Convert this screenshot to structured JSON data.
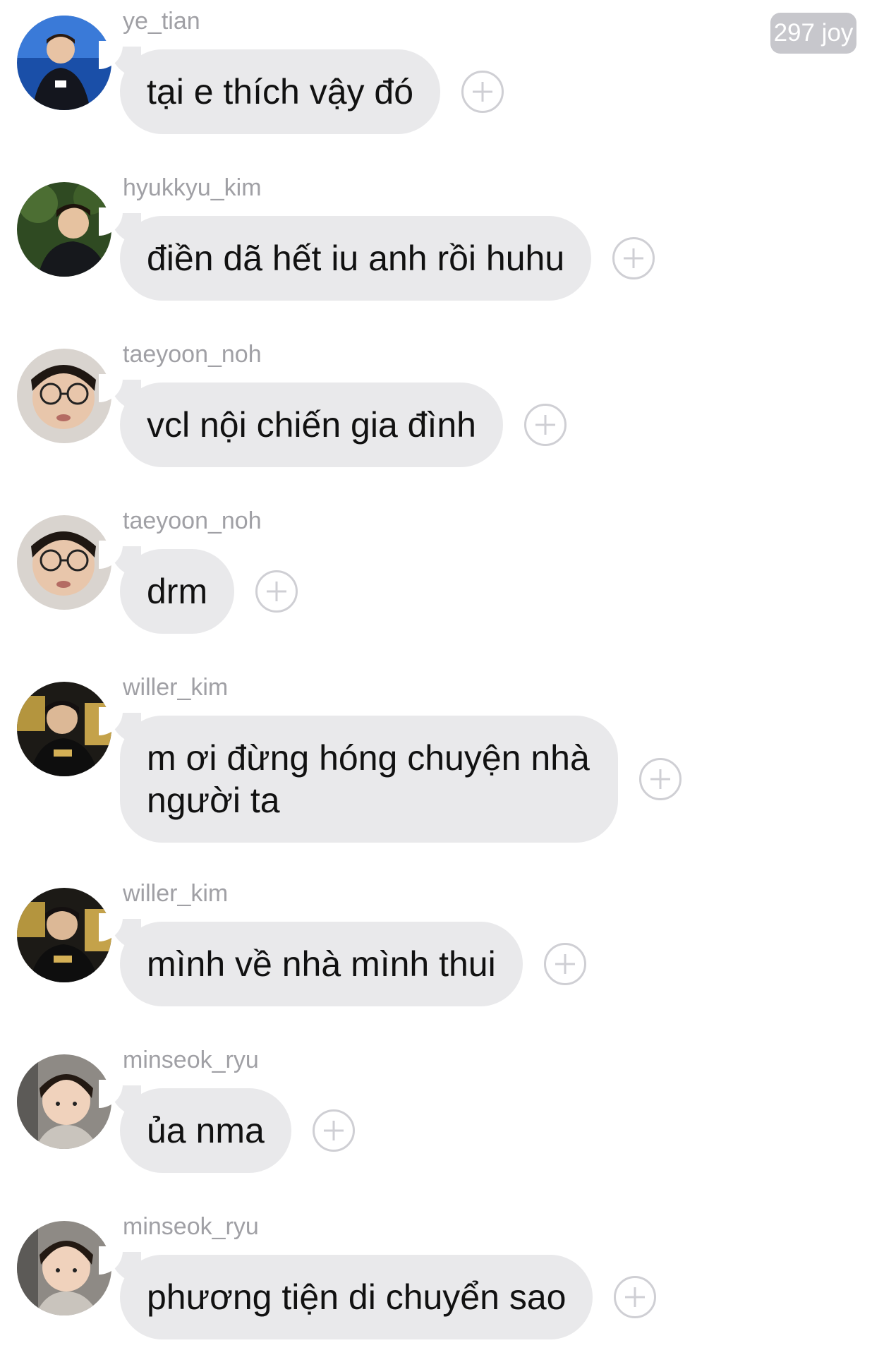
{
  "header": {
    "joy_badge": "297 joy"
  },
  "messages": [
    {
      "username": "ye_tian",
      "text": "tại e thích vậy đó",
      "avatar": "avatar-ye-tian"
    },
    {
      "username": "hyukkyu_kim",
      "text": "điền dã hết iu anh rồi huhu",
      "avatar": "avatar-hyukkyu-kim"
    },
    {
      "username": "taeyoon_noh",
      "text": "vcl nội chiến gia đình",
      "avatar": "avatar-taeyoon-noh"
    },
    {
      "username": "taeyoon_noh",
      "text": "drm",
      "avatar": "avatar-taeyoon-noh"
    },
    {
      "username": "willer_kim",
      "text": "m ơi đừng hóng chuyện nhà người ta",
      "avatar": "avatar-willer-kim"
    },
    {
      "username": "willer_kim",
      "text": "mình về nhà mình thui",
      "avatar": "avatar-willer-kim"
    },
    {
      "username": "minseok_ryu",
      "text": "ủa nma",
      "avatar": "avatar-minseok-ryu"
    },
    {
      "username": "minseok_ryu",
      "text": "phương tiện di chuyển sao",
      "avatar": "avatar-minseok-ryu"
    }
  ],
  "icons": {
    "react": "plus-circle-icon"
  },
  "colors": {
    "bubble": "#e9e9eb",
    "username": "#a0a0a5",
    "badge": "#c7c7cc"
  }
}
